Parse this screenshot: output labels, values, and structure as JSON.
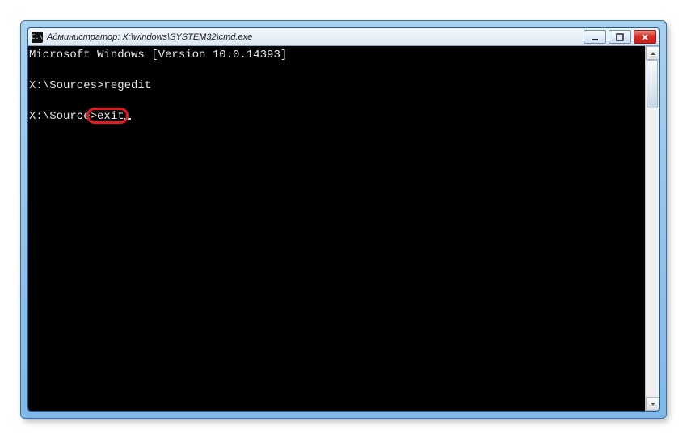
{
  "window": {
    "title": "Администратор: X:\\windows\\SYSTEM32\\cmd.exe",
    "icon_label": "C:\\"
  },
  "console": {
    "lines": {
      "version": "Microsoft Windows [Version 10.0.14393]",
      "blank1": "",
      "prompt1": "X:\\Sources>",
      "cmd1": "regedit",
      "blank2": "",
      "prompt2_left": "X:\\Source",
      "prompt2_right": ">",
      "cmd2": "exit"
    }
  },
  "highlight": {
    "target": "exit"
  },
  "buttons": {
    "minimize": "Minimize",
    "maximize": "Maximize",
    "close": "Close"
  }
}
